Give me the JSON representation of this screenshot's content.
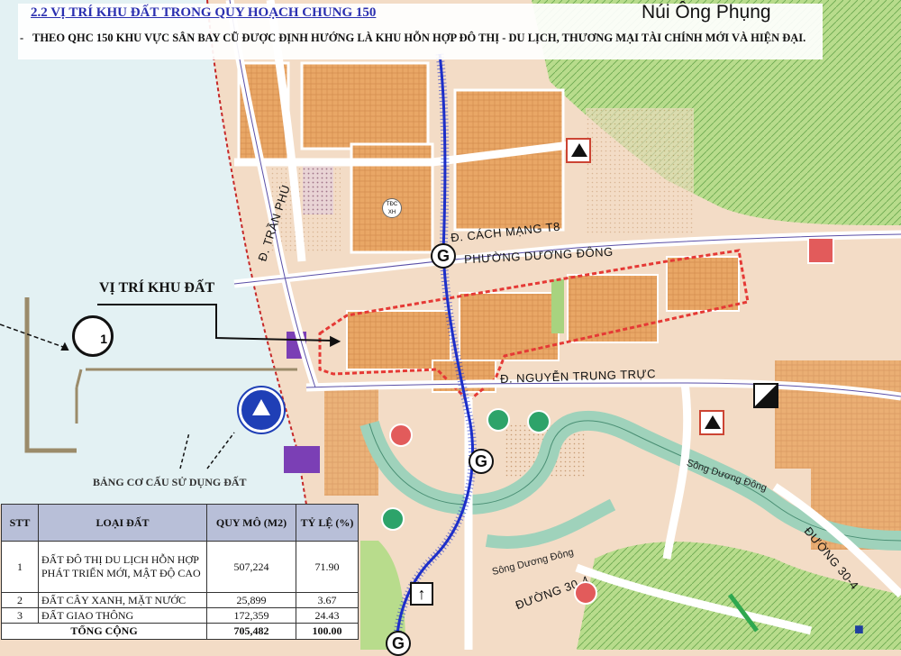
{
  "header": {
    "section_title": "2.2 VỊ TRÍ KHU ĐẤT TRONG QUY HOẠCH CHUNG 150",
    "description": "THEO QHC 150 KHU VỰC SÂN BAY CŨ ĐƯỢC ĐỊNH HƯỚNG LÀ KHU HỖN HỢP ĐÔ THỊ - DU LỊCH, THƯƠNG MẠI TÀI CHÍNH MỚI VÀ HIỆN ĐẠI.",
    "bullet": "-"
  },
  "map_labels": {
    "mountain": "Núi Ông Phụng",
    "street_tran_phu": "Đ. TRẦN PHÚ",
    "street_cmt8": "Đ. CÁCH MẠNG T8",
    "ward": "PHƯỜNG DƯƠNG ĐÔNG",
    "street_ntt": "Đ. NGUYỄN TRUNG TRỰC",
    "river_1": "Sông Dương Đông",
    "river_2": "Sông Dương Đông",
    "road_30_4_a": "ĐƯỜNG 30-4",
    "road_30_4_b": "ĐƯỜNG 30-4",
    "site_label": "VỊ TRÍ KHU ĐẤT",
    "tdc_badge": "TĐC XH",
    "g_marker": "G",
    "airport_number": "1"
  },
  "table": {
    "caption": "BẢNG CƠ CẤU SỬ DỤNG ĐẤT",
    "headers": [
      "STT",
      "LOẠI ĐẤT",
      "QUY MÔ (M2)",
      "TỶ LỆ (%)"
    ],
    "rows": [
      {
        "stt": "1",
        "type": "ĐẤT ĐÔ THỊ DU LỊCH HỖN HỢP PHÁT TRIỂN MỚI, MẬT ĐỘ CAO",
        "area": "507,224",
        "ratio": "71.90"
      },
      {
        "stt": "2",
        "type": "ĐẤT CÂY XANH, MẶT NƯỚC",
        "area": "25,899",
        "ratio": "3.67"
      },
      {
        "stt": "3",
        "type": "ĐẤT GIAO THÔNG",
        "area": "172,359",
        "ratio": "24.43"
      }
    ],
    "total_label": "TỔNG CỘNG",
    "total_area": "705,482",
    "total_ratio": "100.00"
  },
  "colors": {
    "sea": "#e3f1f3",
    "land_base": "#f3dcc6",
    "urban_block": "#e9a766",
    "green_area": "#a8d37f",
    "forest": "#b8dc8c",
    "road": "#ffffff",
    "road_edge": "#5a4fa7",
    "site_boundary": "#e53935",
    "river": "#9fd2bb",
    "axis_road": "#1d2fc9",
    "header_text": "#2a2fb0"
  },
  "icons": [
    "airport-icon",
    "port-icon",
    "g-marker-icon",
    "mountain-triangle-icon",
    "park-icon",
    "hospital-icon",
    "split-square-icon",
    "up-arrow-icon"
  ]
}
